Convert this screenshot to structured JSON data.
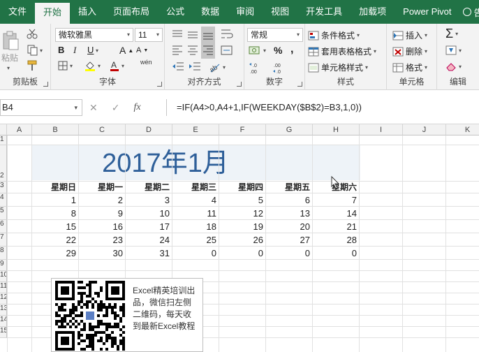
{
  "tabs": [
    "文件",
    "开始",
    "插入",
    "页面布局",
    "公式",
    "数据",
    "审阅",
    "视图",
    "开发工具",
    "加载项",
    "Power Pivot"
  ],
  "tab_help": "告诉",
  "ribbon": {
    "clipboard": {
      "paste": "粘贴",
      "label": "剪贴板"
    },
    "font": {
      "name": "微软雅黑",
      "size": "11",
      "bold": "B",
      "italic": "I",
      "underline": "U",
      "grow": "A",
      "shrink": "A",
      "phonetic": "wén",
      "label": "字体"
    },
    "alignment": {
      "label": "对齐方式"
    },
    "number": {
      "format": "常规",
      "label": "数字"
    },
    "styles": {
      "conditional": "条件格式",
      "table": "套用表格格式",
      "cell": "单元格样式",
      "label": "样式"
    },
    "cells": {
      "insert": "插入",
      "delete": "删除",
      "format": "格式",
      "label": "单元格"
    },
    "editing": {
      "label": "编辑"
    }
  },
  "formula_bar": {
    "name_box": "B4",
    "formula": "=IF(A4>0,A4+1,IF(WEEKDAY($B$2)=B3,1,0))"
  },
  "columns": [
    "A",
    "B",
    "C",
    "D",
    "E",
    "F",
    "G",
    "H",
    "I",
    "J",
    "K"
  ],
  "rows": [
    "1",
    "2",
    "3",
    "4",
    "5",
    "6",
    "7",
    "8",
    "9",
    "10",
    "11",
    "12",
    "13",
    "14",
    "15"
  ],
  "sheet": {
    "title": "2017年1月",
    "weekdays": [
      "星期日",
      "星期一",
      "星期二",
      "星期三",
      "星期四",
      "星期五",
      "星期六"
    ],
    "weeks": [
      [
        "1",
        "2",
        "3",
        "4",
        "5",
        "6",
        "7"
      ],
      [
        "8",
        "9",
        "10",
        "11",
        "12",
        "13",
        "14"
      ],
      [
        "15",
        "16",
        "17",
        "18",
        "19",
        "20",
        "21"
      ],
      [
        "22",
        "23",
        "24",
        "25",
        "26",
        "27",
        "28"
      ],
      [
        "29",
        "30",
        "31",
        "0",
        "0",
        "0",
        "0"
      ]
    ]
  },
  "promo": {
    "line1": "Excel精英培训出",
    "line2": "品，微信扫左侧",
    "line3": "二维码，每天收",
    "line4": "到最新Excel教程"
  },
  "colors": {
    "accent": "#217346",
    "title": "#2e5f99"
  }
}
